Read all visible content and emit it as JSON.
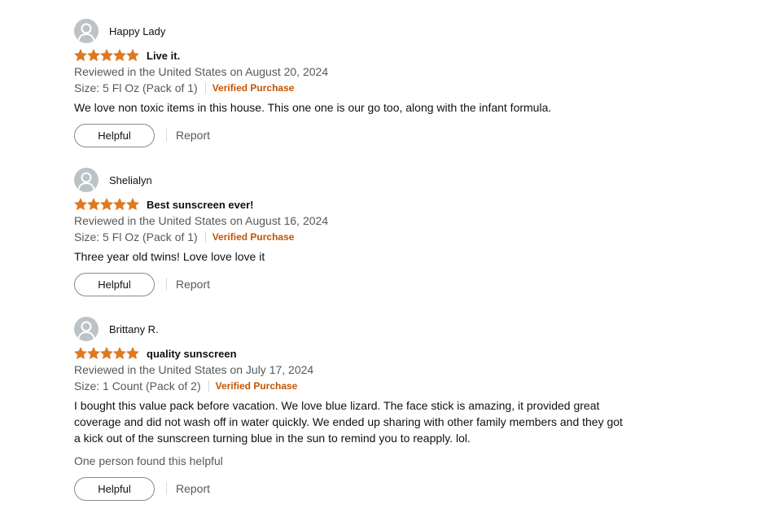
{
  "colors": {
    "star": "#de7921",
    "verified": "#c45500",
    "muted": "#565959",
    "avatar_bg": "#bcc3c7"
  },
  "reviews": [
    {
      "reviewer_name": "Happy Lady",
      "rating": 5,
      "title": "Live it.",
      "date": "Reviewed in the United States on August 20, 2024",
      "size": "Size: 5 Fl Oz (Pack of 1)",
      "verified": "Verified Purchase",
      "body": "We love non toxic items in this house. This one one is our go too, along with the infant formula.",
      "helpful_label": "Helpful",
      "report_label": "Report"
    },
    {
      "reviewer_name": "Shelialyn",
      "rating": 5,
      "title": "Best sunscreen ever!",
      "date": "Reviewed in the United States on August 16, 2024",
      "size": "Size: 5 Fl Oz (Pack of 1)",
      "verified": "Verified Purchase",
      "body": "Three year old twins! Love love love it",
      "helpful_label": "Helpful",
      "report_label": "Report"
    },
    {
      "reviewer_name": "Brittany R.",
      "rating": 5,
      "title": "quality sunscreen",
      "date": "Reviewed in the United States on July 17, 2024",
      "size": "Size: 1 Count (Pack of 2)",
      "verified": "Verified Purchase",
      "body": "I bought this value pack before vacation. We love blue lizard. The face stick is amazing, it provided great coverage and did not wash off in water quickly. We ended up sharing with other family members and they got a kick out of the sunscreen turning blue in the sun to remind you to reapply. lol.",
      "found_helpful": "One person found this helpful",
      "helpful_label": "Helpful",
      "report_label": "Report"
    }
  ]
}
